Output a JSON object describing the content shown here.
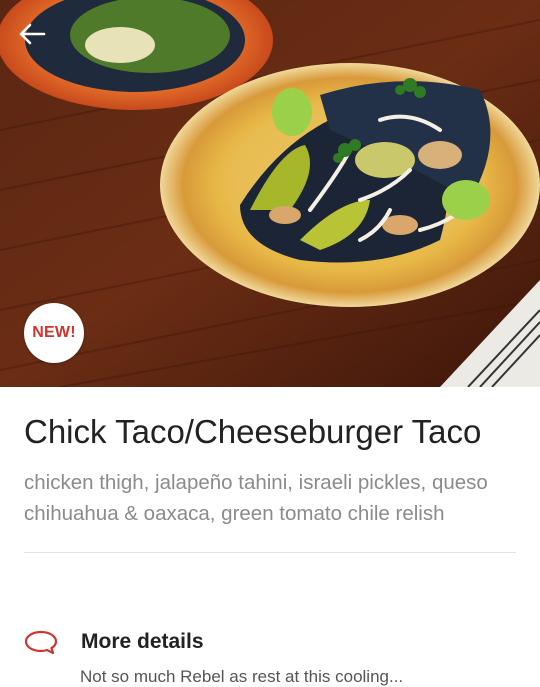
{
  "hero": {
    "image_alt": "Tacos with chicken, pickles and lime on a yellow plate",
    "back_icon": "arrow-left-icon",
    "badge": "NEW!",
    "colors": {
      "badge_text": "#d0342c"
    }
  },
  "item": {
    "title": "Chick Taco/Cheeseburger Taco",
    "description": "chicken thigh, jalapeño tahini, israeli pickles, queso chihuahua & oaxaca, green tomato chile relish"
  },
  "details": {
    "icon": "speech-bubble-icon",
    "label": "More details",
    "preview": "Not so much Rebel as rest at this cooling..."
  }
}
